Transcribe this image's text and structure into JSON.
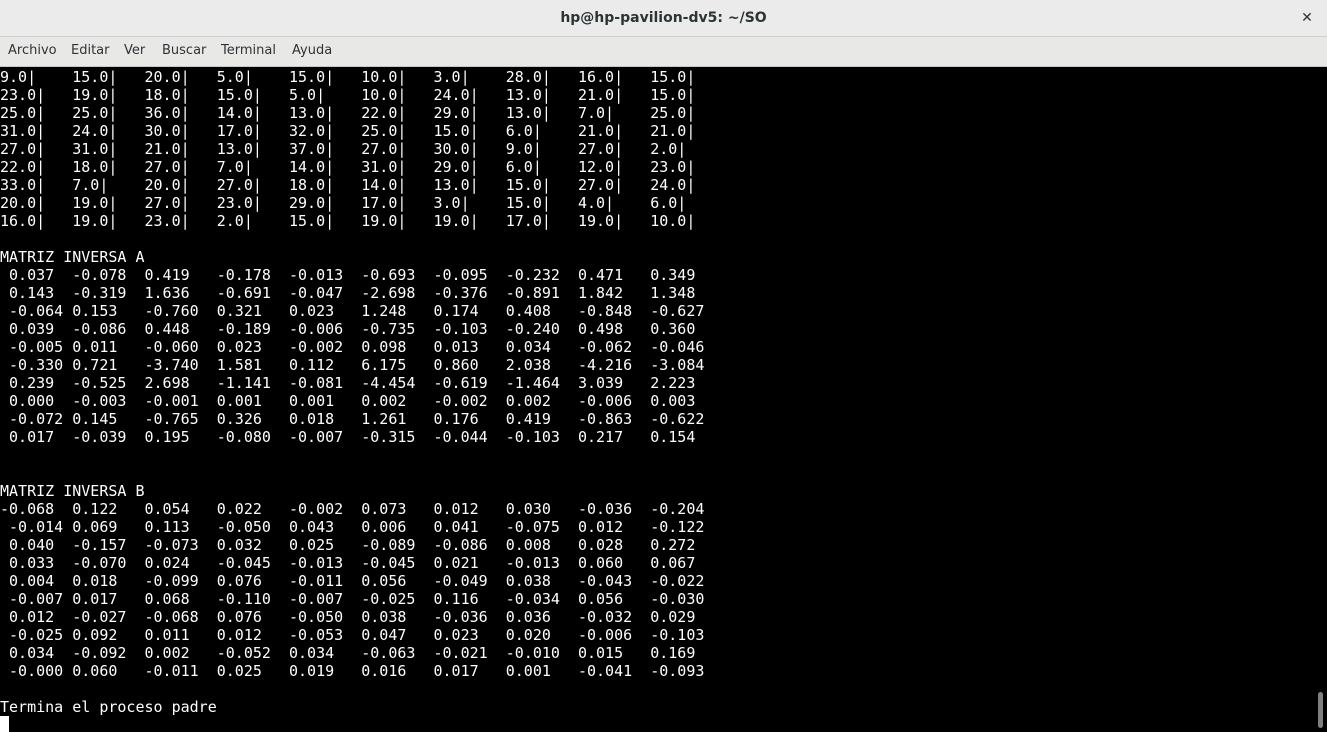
{
  "window": {
    "title": "hp@hp-pavilion-dv5: ~/SO",
    "close_symbol": "✕"
  },
  "menu": [
    "Archivo",
    "Editar",
    "Ver",
    "Buscar",
    "Terminal",
    "Ayuda"
  ],
  "terminal_lines": [
    "9.0|    15.0|   20.0|   5.0|    15.0|   10.0|   3.0|    28.0|   16.0|   15.0|",
    "23.0|   19.0|   18.0|   15.0|   5.0|    10.0|   24.0|   13.0|   21.0|   15.0|",
    "25.0|   25.0|   36.0|   14.0|   13.0|   22.0|   29.0|   13.0|   7.0|    25.0|",
    "31.0|   24.0|   30.0|   17.0|   32.0|   25.0|   15.0|   6.0|    21.0|   21.0|",
    "27.0|   31.0|   21.0|   13.0|   37.0|   27.0|   30.0|   9.0|    27.0|   2.0|",
    "22.0|   18.0|   27.0|   7.0|    14.0|   31.0|   29.0|   6.0|    12.0|   23.0|",
    "33.0|   7.0|    20.0|   27.0|   18.0|   14.0|   13.0|   15.0|   27.0|   24.0|",
    "20.0|   19.0|   27.0|   23.0|   29.0|   17.0|   3.0|    15.0|   4.0|    6.0|",
    "16.0|   19.0|   23.0|   2.0|    15.0|   19.0|   19.0|   17.0|   19.0|   10.0|",
    "",
    "MATRIZ INVERSA A",
    " 0.037  -0.078  0.419   -0.178  -0.013  -0.693  -0.095  -0.232  0.471   0.349",
    " 0.143  -0.319  1.636   -0.691  -0.047  -2.698  -0.376  -0.891  1.842   1.348",
    " -0.064 0.153   -0.760  0.321   0.023   1.248   0.174   0.408   -0.848  -0.627",
    " 0.039  -0.086  0.448   -0.189  -0.006  -0.735  -0.103  -0.240  0.498   0.360",
    " -0.005 0.011   -0.060  0.023   -0.002  0.098   0.013   0.034   -0.062  -0.046",
    " -0.330 0.721   -3.740  1.581   0.112   6.175   0.860   2.038   -4.216  -3.084",
    " 0.239  -0.525  2.698   -1.141  -0.081  -4.454  -0.619  -1.464  3.039   2.223",
    " 0.000  -0.003  -0.001  0.001   0.001   0.002   -0.002  0.002   -0.006  0.003",
    " -0.072 0.145   -0.765  0.326   0.018   1.261   0.176   0.419   -0.863  -0.622",
    " 0.017  -0.039  0.195   -0.080  -0.007  -0.315  -0.044  -0.103  0.217   0.154",
    "",
    "",
    "MATRIZ INVERSA B",
    "-0.068  0.122   0.054   0.022   -0.002  0.073   0.012   0.030   -0.036  -0.204",
    " -0.014 0.069   0.113   -0.050  0.043   0.006   0.041   -0.075  0.012   -0.122",
    " 0.040  -0.157  -0.073  0.032   0.025   -0.089  -0.086  0.008   0.028   0.272",
    " 0.033  -0.070  0.024   -0.045  -0.013  -0.045  0.021   -0.013  0.060   0.067",
    " 0.004  0.018   -0.099  0.076   -0.011  0.056   -0.049  0.038   -0.043  -0.022",
    " -0.007 0.017   0.068   -0.110  -0.007  -0.025  0.116   -0.034  0.056   -0.030",
    " 0.012  -0.027  -0.068  0.076   -0.050  0.038   -0.036  0.036   -0.032  0.029",
    " -0.025 0.092   0.011   0.012   -0.053  0.047   0.023   0.020   -0.006  -0.103",
    " 0.034  -0.092  0.002   -0.052  0.034   -0.063  -0.021  -0.010  0.015   0.169",
    " -0.000 0.060   -0.011  0.025   0.019   0.016   0.017   0.001   -0.041  -0.093",
    "",
    "Termina el proceso padre"
  ],
  "colors": {
    "terminal_background": "#000000",
    "terminal_text": "#ffffff",
    "titlebar": "#ebebeb",
    "menubar": "#e8e8e7"
  }
}
